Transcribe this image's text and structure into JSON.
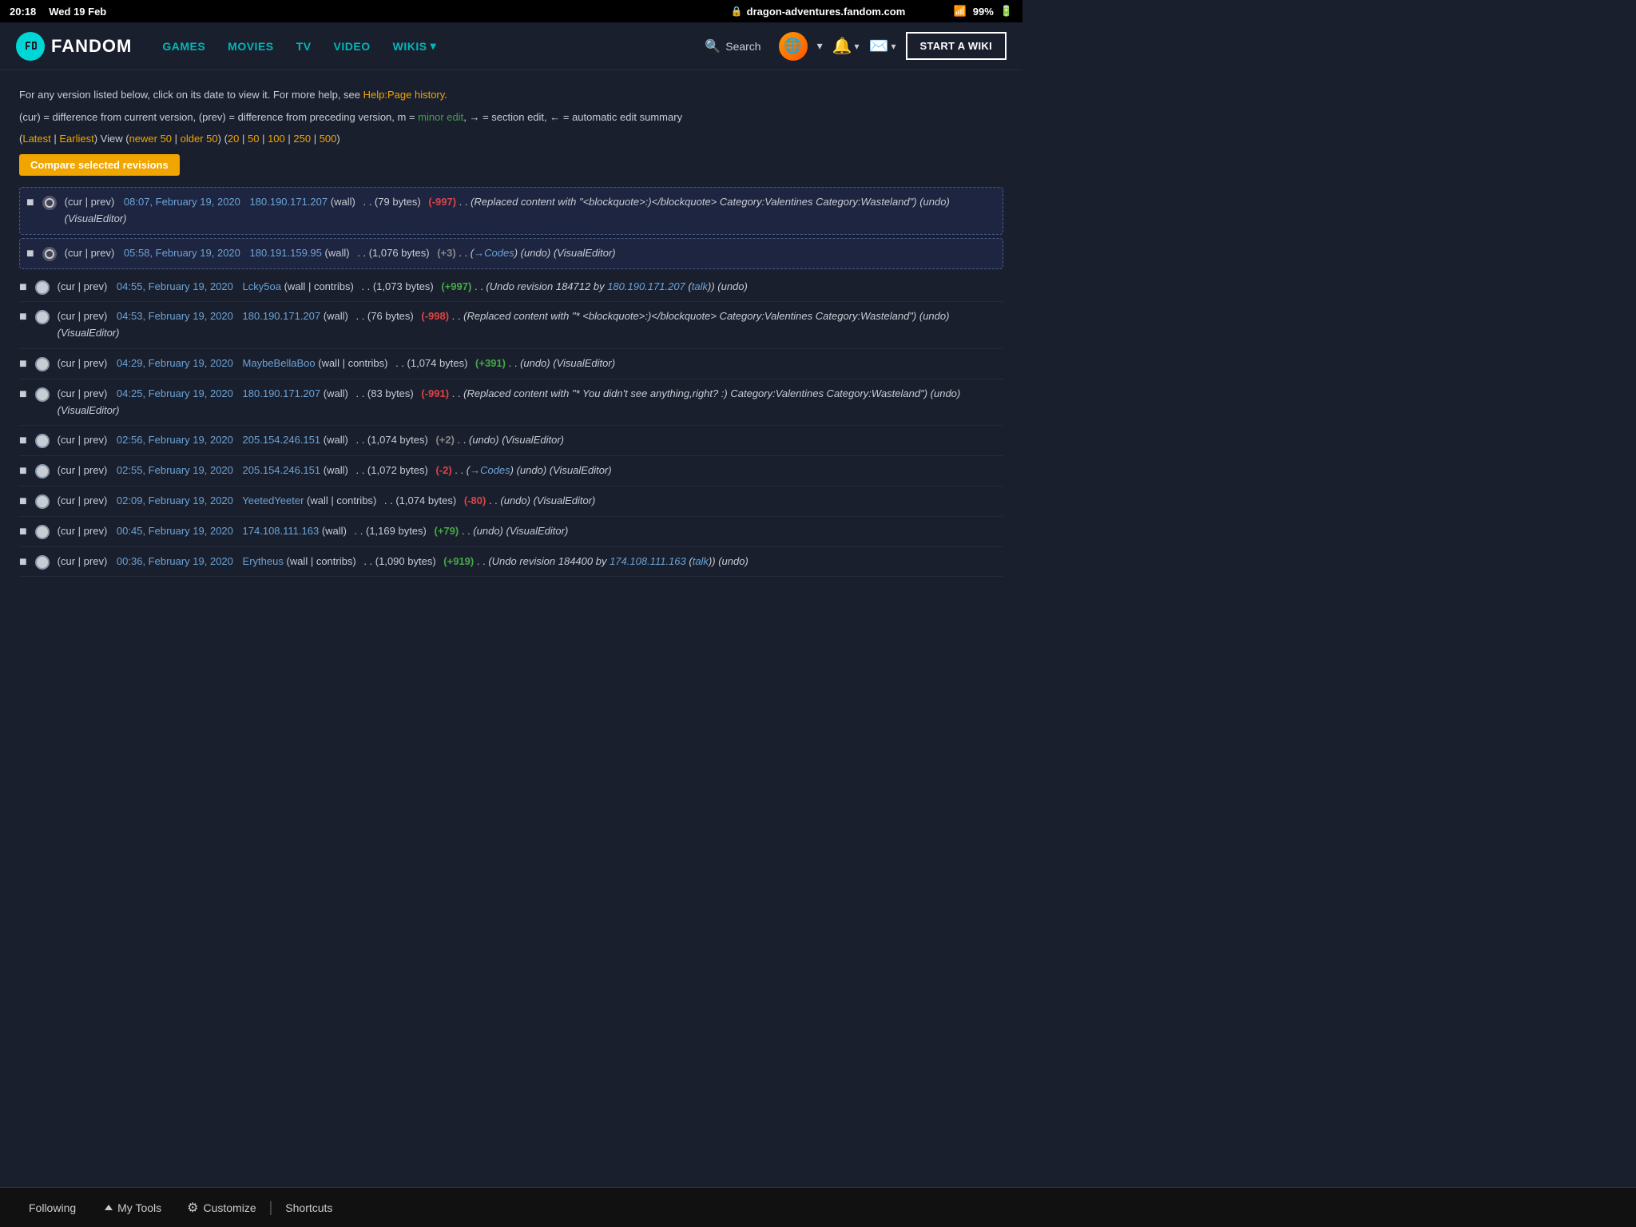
{
  "status_bar": {
    "time": "20:18",
    "date": "Wed 19 Feb",
    "domain": "dragon-adventures.fandom.com",
    "wifi": "WiFi",
    "battery": "99%"
  },
  "nav": {
    "logo_text": "FANDOM",
    "links": [
      "GAMES",
      "MOVIES",
      "TV",
      "VIDEO",
      "WIKIS ▾"
    ],
    "search_label": "Search",
    "start_wiki_label": "START A WIKI"
  },
  "page": {
    "info1": "For any version listed below, click on its date to view it. For more help, see ",
    "info1_link": "Help:Page history",
    "info1_end": ".",
    "info2_pre": "(cur) = difference from current version, (prev) = difference from preceding version, m = ",
    "info2_minor": "minor edit",
    "info2_post": ", → = section edit, ← = automatic edit summary",
    "pagination": {
      "latest": "Latest",
      "earliest": "Earliest",
      "view": "View (",
      "newer50": "newer 50",
      "older50": "older 50",
      "counts": [
        "20",
        "50",
        "100",
        "250",
        "500"
      ]
    },
    "compare_btn": "Compare selected revisions"
  },
  "revisions": [
    {
      "id": 1,
      "selected": true,
      "cur_prev": "(cur | prev)",
      "date": "08:07, February 19, 2020",
      "user": "180.190.171.207",
      "user_link": "wall",
      "bytes": "(79 bytes)",
      "diff": "(-997)",
      "diff_type": "neg",
      "comment": "(Replaced content with \"<blockquote>:)</blockquote> Category:Valentines Category:Wasteland\") (undo) (VisualEditor)",
      "show_undo": true,
      "visual_editor": true
    },
    {
      "id": 2,
      "selected": true,
      "cur_prev": "(cur | prev)",
      "date": "05:58, February 19, 2020",
      "user": "180.191.159.95",
      "user_link": "wall",
      "bytes": "(1,076 bytes)",
      "diff": "(+3)",
      "diff_type": "pos_small",
      "comment": "(→Codes) (undo) (VisualEditor)",
      "show_undo": true,
      "visual_editor": true,
      "arrow_comment": true
    },
    {
      "id": 3,
      "selected": false,
      "cur_prev": "(cur | prev)",
      "date": "04:55, February 19, 2020",
      "user": "Lcky5oa",
      "user_links": "wall | contribs",
      "bytes": "(1,073 bytes)",
      "diff": "(+997)",
      "diff_type": "pos",
      "comment": "(Undo revision 184712 by 180.190.171.207 (talk)) (undo)",
      "show_undo": true,
      "user_is_link": true
    },
    {
      "id": 4,
      "selected": false,
      "cur_prev": "(cur | prev)",
      "date": "04:53, February 19, 2020",
      "user": "180.190.171.207",
      "user_link": "wall",
      "bytes": "(76 bytes)",
      "diff": "(-998)",
      "diff_type": "neg",
      "comment": "(Replaced content with \"* <blockquote>:)</blockquote> Category:Valentines Category:Wasteland\") (undo) (VisualEditor)",
      "show_undo": true,
      "visual_editor": true
    },
    {
      "id": 5,
      "selected": false,
      "cur_prev": "(cur | prev)",
      "date": "04:29, February 19, 2020",
      "user": "MaybeBellaBoo",
      "user_links": "wall | contribs",
      "bytes": "(1,074 bytes)",
      "diff": "(+391)",
      "diff_type": "pos",
      "comment": "(undo) (VisualEditor)",
      "show_undo": true,
      "visual_editor": true
    },
    {
      "id": 6,
      "selected": false,
      "cur_prev": "(cur | prev)",
      "date": "04:25, February 19, 2020",
      "user": "180.190.171.207",
      "user_link": "wall",
      "bytes": "(83 bytes)",
      "diff": "(-991)",
      "diff_type": "neg",
      "comment": "(Replaced content with \"* You didn't see anything,right? :) Category:Valentines Category:Wasteland\") (undo) (VisualEditor)",
      "show_undo": true,
      "visual_editor": true
    },
    {
      "id": 7,
      "selected": false,
      "cur_prev": "(cur | prev)",
      "date": "02:56, February 19, 2020",
      "user": "205.154.246.151",
      "user_link": "wall",
      "bytes": "(1,074 bytes)",
      "diff": "(+2)",
      "diff_type": "pos_small",
      "comment": "(undo) (VisualEditor)",
      "show_undo": true,
      "visual_editor": true
    },
    {
      "id": 8,
      "selected": false,
      "cur_prev": "(cur | prev)",
      "date": "02:55, February 19, 2020",
      "user": "205.154.246.151",
      "user_link": "wall",
      "bytes": "(1,072 bytes)",
      "diff": "(-2)",
      "diff_type": "neg_small",
      "comment": "(→Codes) (undo) (VisualEditor)",
      "show_undo": true,
      "visual_editor": true,
      "arrow_comment": true
    },
    {
      "id": 9,
      "selected": false,
      "cur_prev": "(cur | prev)",
      "date": "02:09, February 19, 2020",
      "user": "YeetedYeeter",
      "user_links": "wall | contribs",
      "bytes": "(1,074 bytes)",
      "diff": "(-80)",
      "diff_type": "neg",
      "comment": "(undo) (VisualEditor)",
      "show_undo": true,
      "visual_editor": true
    },
    {
      "id": 10,
      "selected": false,
      "cur_prev": "(cur | prev)",
      "date": "00:45, February 19, 2020",
      "user": "174.108.111.163",
      "user_link": "wall",
      "bytes": "(1,169 bytes)",
      "diff": "(+79)",
      "diff_type": "pos",
      "comment": "(undo) (VisualEditor)",
      "show_undo": true,
      "visual_editor": true
    },
    {
      "id": 11,
      "selected": false,
      "cur_prev": "(cur | prev)",
      "date": "00:36, February 19, 2020",
      "user": "Erytheus",
      "user_links": "wall | contribs",
      "bytes": "(1,090 bytes)",
      "diff": "(+919)",
      "diff_type": "pos",
      "comment": "(Undo revision 184400 by 174.108.111.163 (talk)) (undo)",
      "show_undo": true
    }
  ],
  "bottom_bar": {
    "following_label": "Following",
    "my_tools_label": "My Tools",
    "customize_label": "Customize",
    "shortcuts_label": "Shortcuts"
  }
}
